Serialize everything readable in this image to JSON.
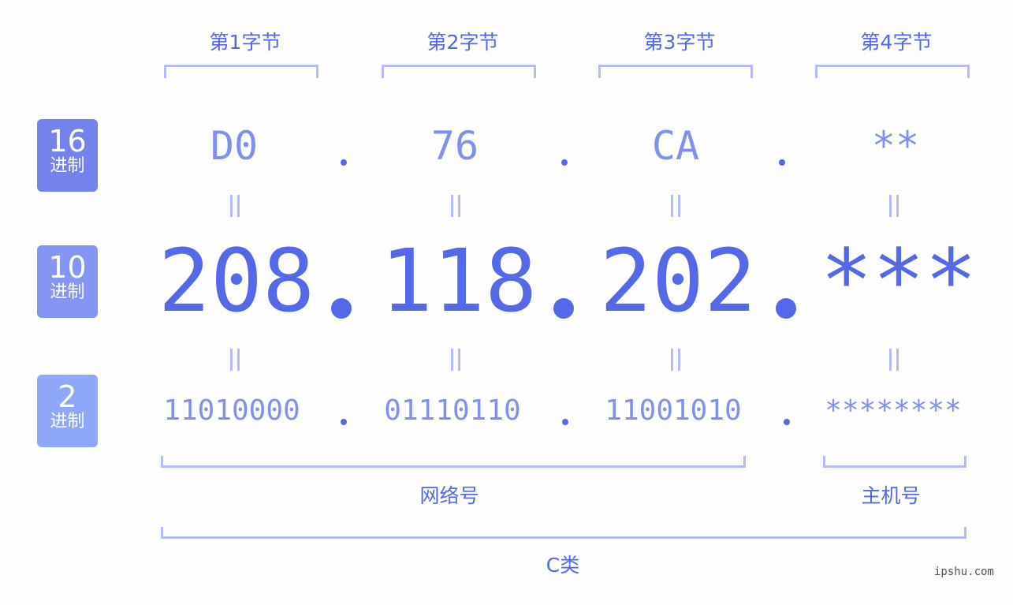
{
  "bytes": [
    "第1字节",
    "第2字节",
    "第3字节",
    "第4字节"
  ],
  "badges": {
    "hex": {
      "num": "16",
      "unit": "进制",
      "color": "#7582ec"
    },
    "dec": {
      "num": "10",
      "unit": "进制",
      "color": "#8495f3"
    },
    "bin": {
      "num": "2",
      "unit": "进制",
      "color": "#8ea7f9"
    }
  },
  "hex_values": [
    "D0",
    "76",
    "CA",
    "**"
  ],
  "dec_values": [
    "208",
    "118",
    "202",
    "***"
  ],
  "bin_values": [
    "11010000",
    "01110110",
    "11001010",
    "********"
  ],
  "separator": ".",
  "groups": {
    "network": "网络号",
    "host": "主机号",
    "class": "C类"
  },
  "watermark": "ipshu.com"
}
